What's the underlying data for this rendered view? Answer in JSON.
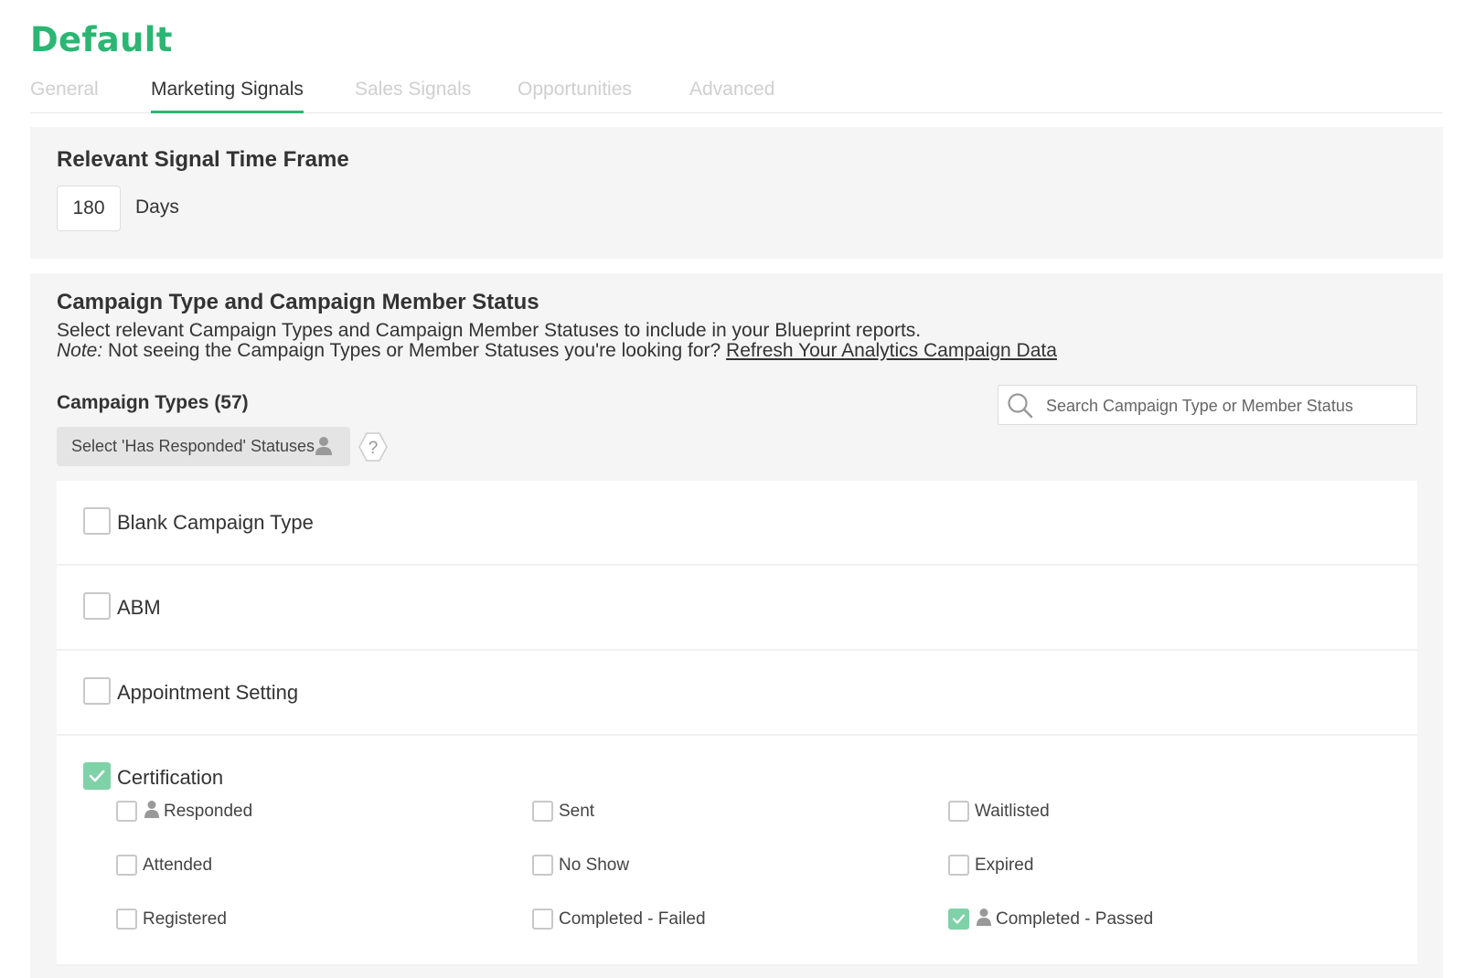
{
  "page": {
    "title": "Default"
  },
  "tabs": [
    {
      "label": "General",
      "active": false
    },
    {
      "label": "Marketing Signals",
      "active": true
    },
    {
      "label": "Sales Signals",
      "active": false
    },
    {
      "label": "Opportunities",
      "active": false
    },
    {
      "label": "Advanced",
      "active": false
    }
  ],
  "timeframe": {
    "heading": "Relevant Signal Time Frame",
    "value": "180",
    "unit": "Days"
  },
  "campaign": {
    "heading": "Campaign Type and Campaign Member Status",
    "description": "Select relevant Campaign Types and Campaign Member Statuses to include in your Blueprint reports.",
    "note_label": "Note:",
    "note_text": " Not seeing the Campaign Types or Member Statuses you're looking for? ",
    "refresh_link": "Refresh Your Analytics Campaign Data",
    "types_heading": "Campaign Types (57)",
    "search_placeholder": "Search Campaign Type or Member Status",
    "responded_button": "Select 'Has Responded' Statuses",
    "help_glyph": "?",
    "types": [
      {
        "label": "Blank Campaign Type",
        "checked": false
      },
      {
        "label": "ABM",
        "checked": false
      },
      {
        "label": "Appointment Setting",
        "checked": false
      },
      {
        "label": "Certification",
        "checked": true,
        "statuses": [
          {
            "label": "Responded",
            "checked": false,
            "responded": true
          },
          {
            "label": "Sent",
            "checked": false,
            "responded": false
          },
          {
            "label": "Waitlisted",
            "checked": false,
            "responded": false
          },
          {
            "label": "Attended",
            "checked": false,
            "responded": false
          },
          {
            "label": "No Show",
            "checked": false,
            "responded": false
          },
          {
            "label": "Expired",
            "checked": false,
            "responded": false
          },
          {
            "label": "Registered",
            "checked": false,
            "responded": false
          },
          {
            "label": "Completed - Failed",
            "checked": false,
            "responded": false
          },
          {
            "label": "Completed - Passed",
            "checked": true,
            "responded": true
          }
        ]
      }
    ]
  },
  "colors": {
    "accent": "#2bb673",
    "checkbox_checked": "#7fd1a8",
    "panel_bg": "#f5f5f5",
    "inactive_tab": "#cfcfcf"
  },
  "icons": {
    "search": "search-icon",
    "person": "person-icon",
    "help": "help-icon",
    "check": "check-icon"
  }
}
